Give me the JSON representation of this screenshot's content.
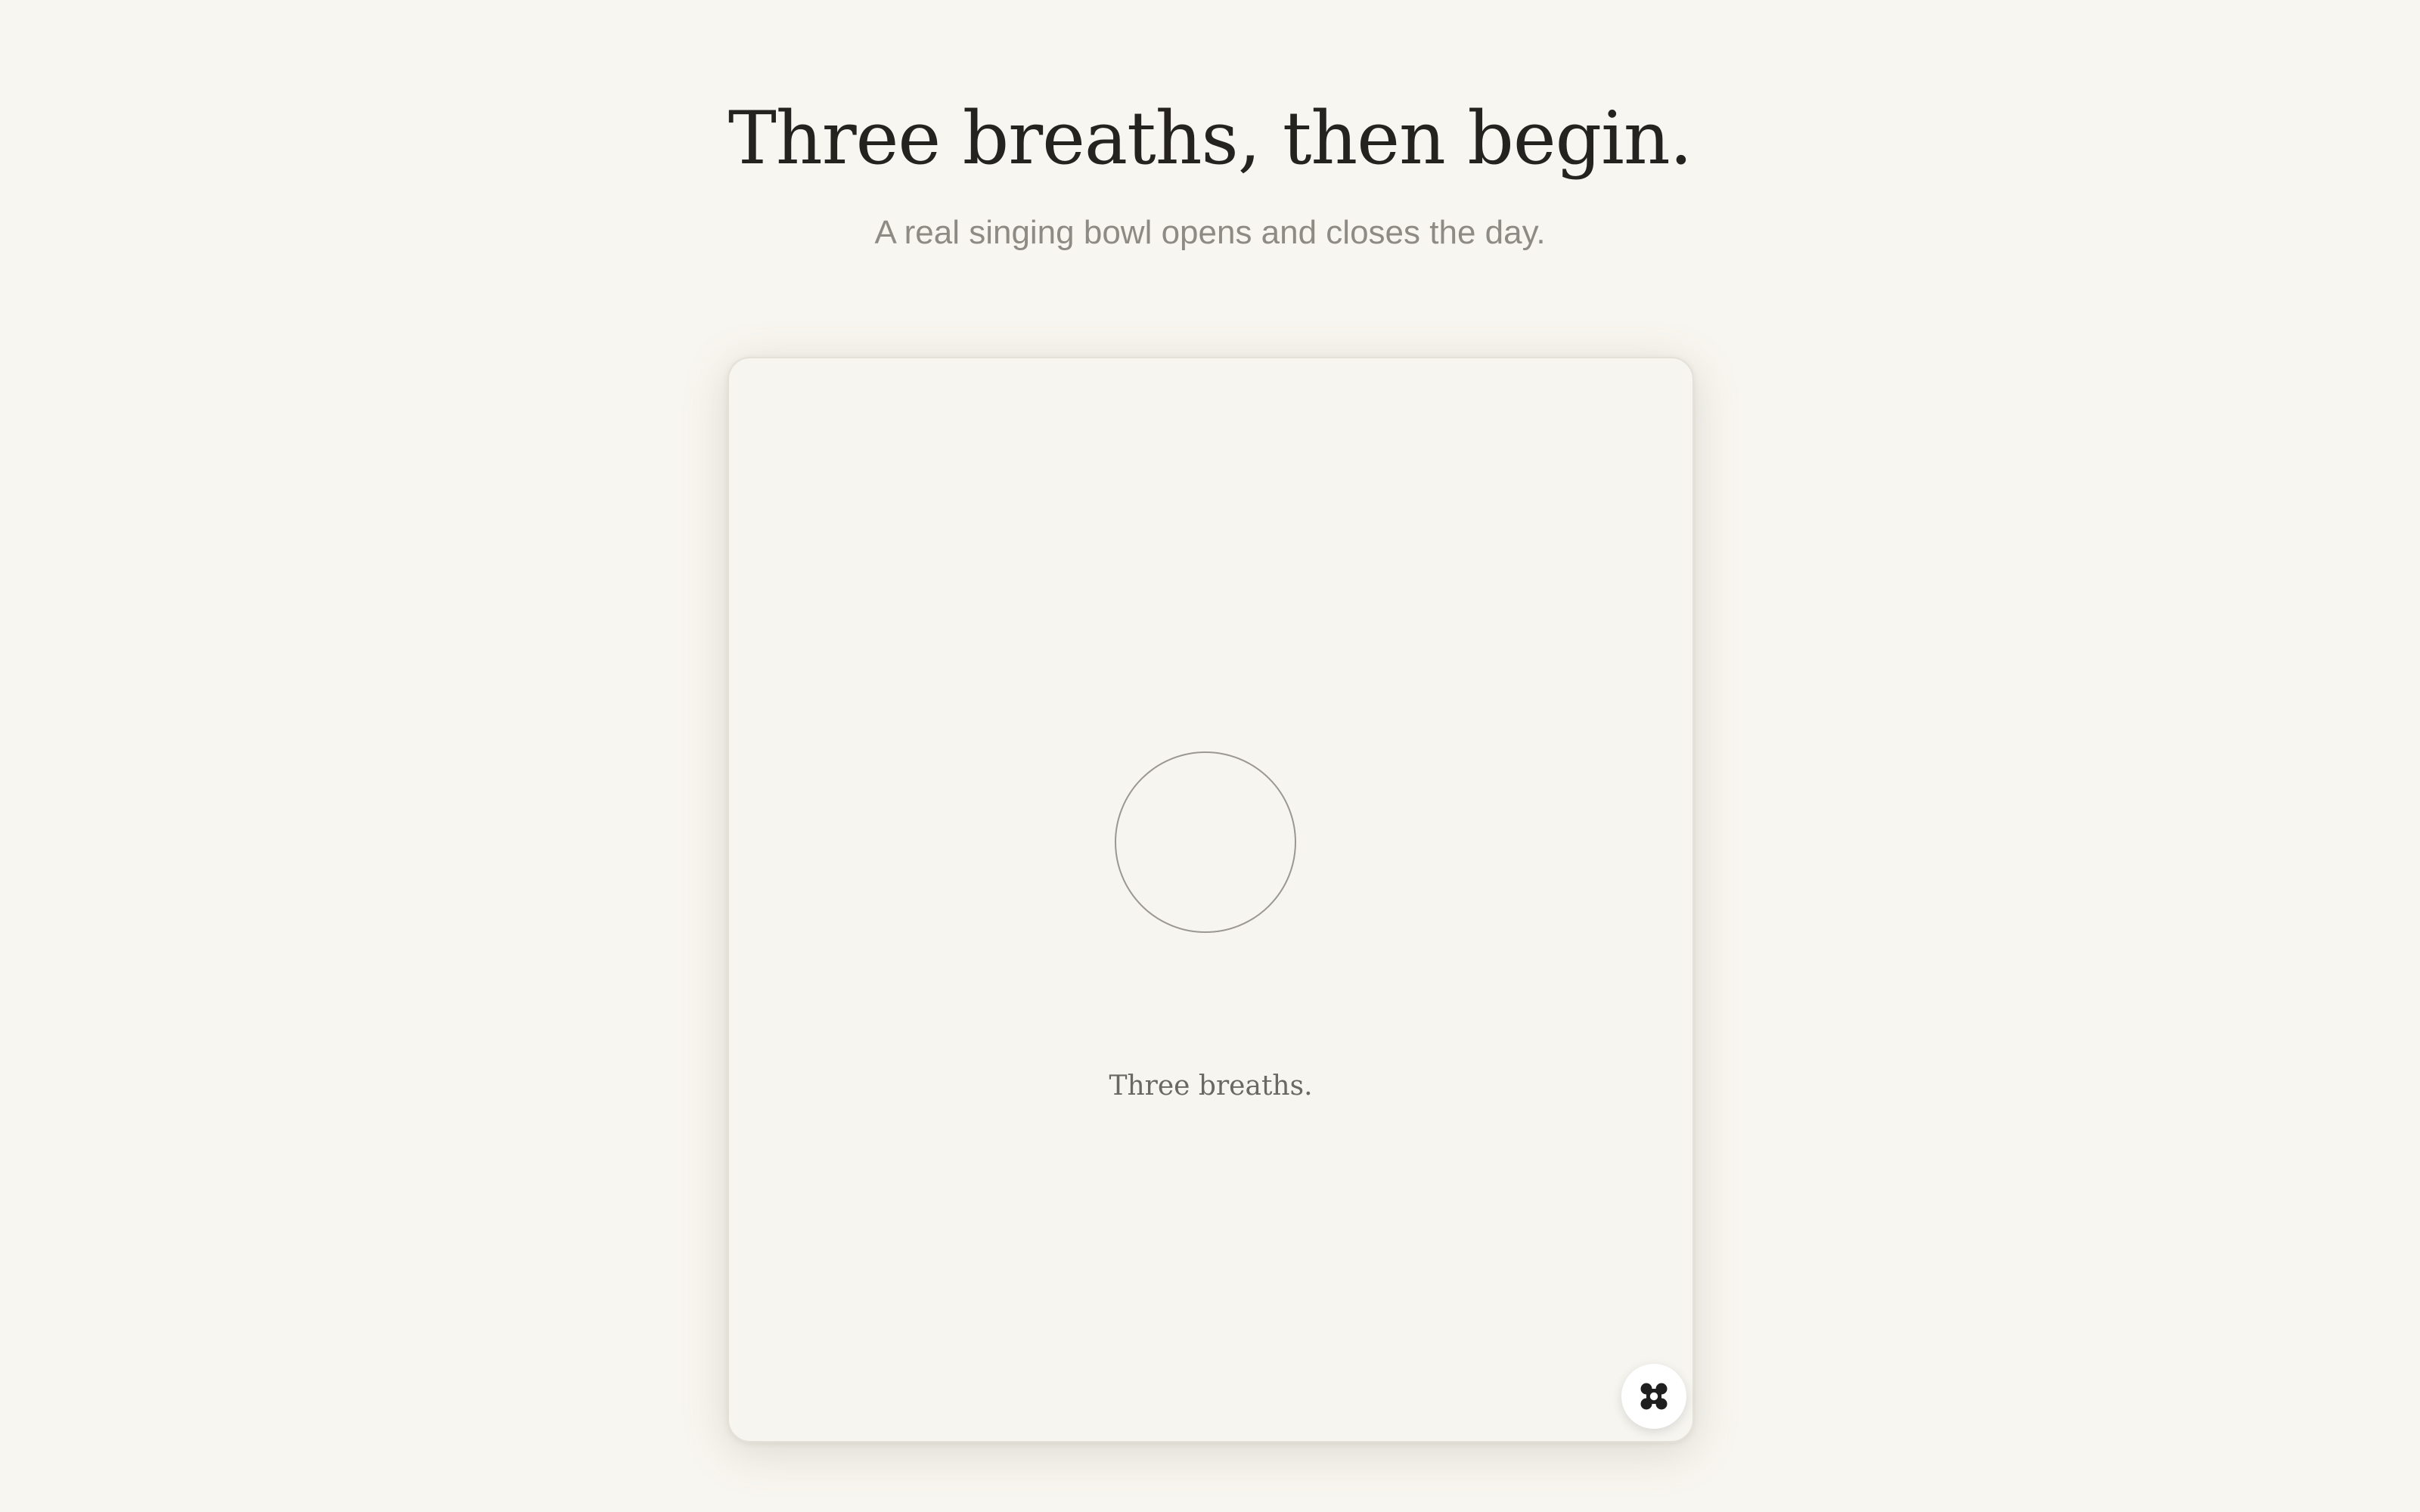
{
  "header": {
    "title": "Three breaths, then begin.",
    "subtitle": "A real singing bowl opens and closes the day."
  },
  "card": {
    "breath_label": "Three breaths.",
    "expand_icon": "expand-icon"
  }
}
